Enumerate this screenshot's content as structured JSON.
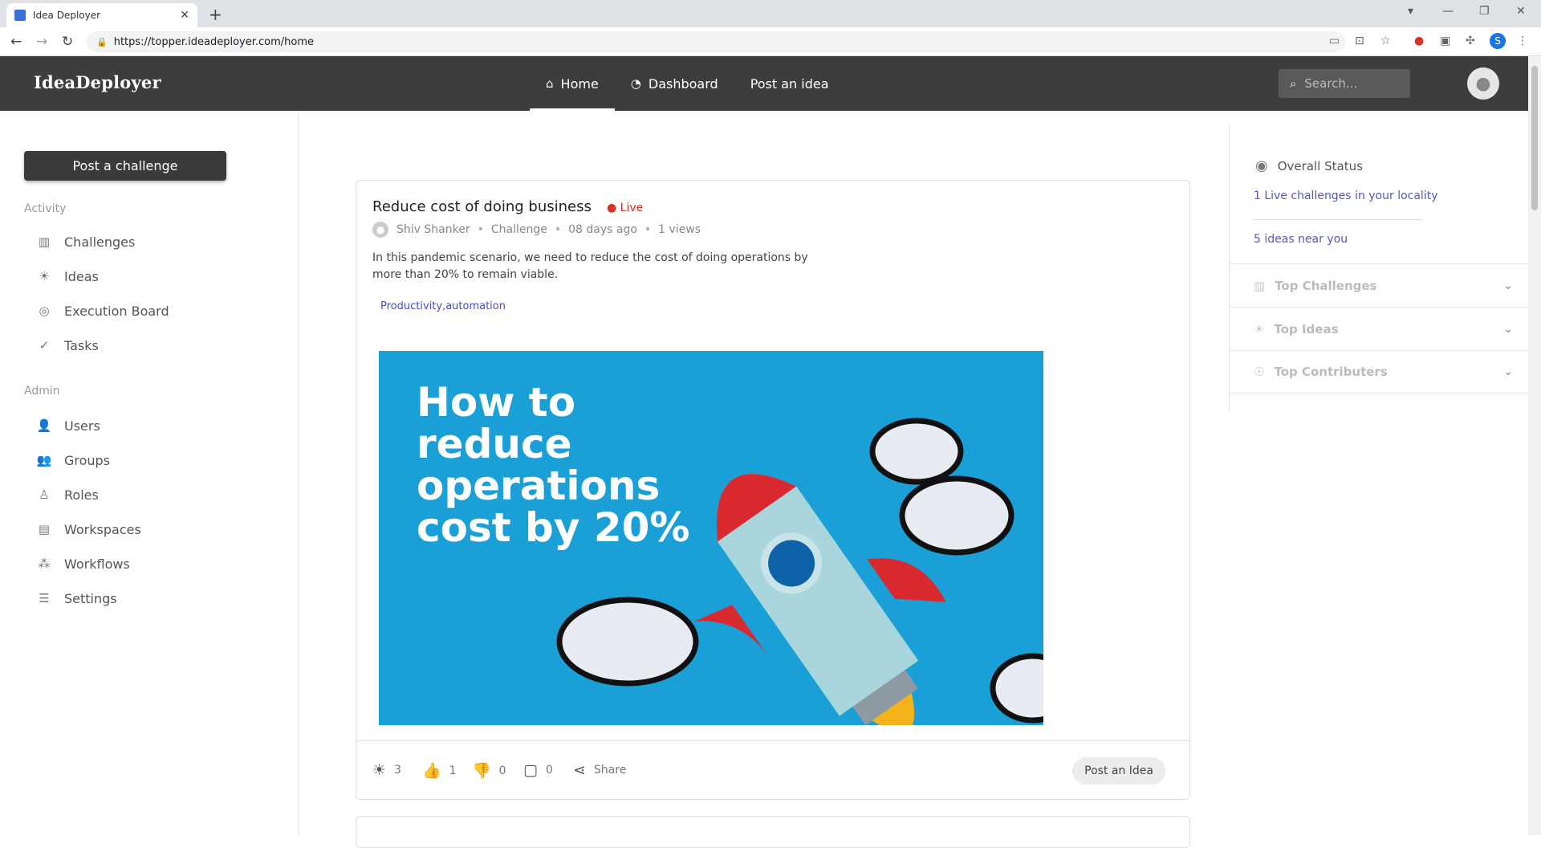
{
  "browser": {
    "tab_title": "Idea Deployer",
    "tab_close": "✕",
    "new_tab": "+",
    "url": "https://topper.ideadeployer.com/home",
    "profile_initial": "S"
  },
  "header": {
    "logo": "IdeaDeployer",
    "nav": [
      {
        "label": "Home",
        "icon": "home-icon",
        "active": true
      },
      {
        "label": "Dashboard",
        "icon": "dashboard-icon",
        "active": false
      },
      {
        "label": "Post an idea",
        "icon": "",
        "active": false
      }
    ],
    "search_placeholder": "Search..."
  },
  "sidebar": {
    "post_challenge_label": "Post a challenge",
    "activity_label": "Activity",
    "activity_items": [
      {
        "label": "Challenges",
        "icon": "bar-chart-icon"
      },
      {
        "label": "Ideas",
        "icon": "lightbulb-icon"
      },
      {
        "label": "Execution Board",
        "icon": "target-icon"
      },
      {
        "label": "Tasks",
        "icon": "check-circle-icon"
      }
    ],
    "admin_label": "Admin",
    "admin_items": [
      {
        "label": "Users",
        "icon": "user-icon"
      },
      {
        "label": "Groups",
        "icon": "group-icon"
      },
      {
        "label": "Roles",
        "icon": "roles-icon"
      },
      {
        "label": "Workspaces",
        "icon": "workspace-icon"
      },
      {
        "label": "Workflows",
        "icon": "workflow-icon"
      },
      {
        "label": "Settings",
        "icon": "sliders-icon"
      }
    ]
  },
  "post": {
    "title": "Reduce cost of doing business",
    "status": "Live",
    "author": "Shiv Shanker",
    "type": "Challenge",
    "age": "08 days ago",
    "views": "1 views",
    "description": "In this pandemic scenario, we need to reduce the cost of doing operations by more than 20% to remain viable.",
    "tags": "Productivity,automation",
    "image_text": "How to\nreduce\noperations\ncost by 20%",
    "idea_count": "3",
    "likes": "1",
    "dislikes": "0",
    "comments": "0",
    "share_label": "Share",
    "post_idea_label": "Post an Idea"
  },
  "right_panel": {
    "overall_status_label": "Overall Status",
    "live_challenges_link": "1 Live challenges in your locality",
    "ideas_near_link": "5 ideas near you",
    "sections": [
      {
        "label": "Top Challenges",
        "icon": "bar-chart-icon"
      },
      {
        "label": "Top Ideas",
        "icon": "lightbulb-icon"
      },
      {
        "label": "Top Contributers",
        "icon": "hands-icon"
      }
    ]
  }
}
